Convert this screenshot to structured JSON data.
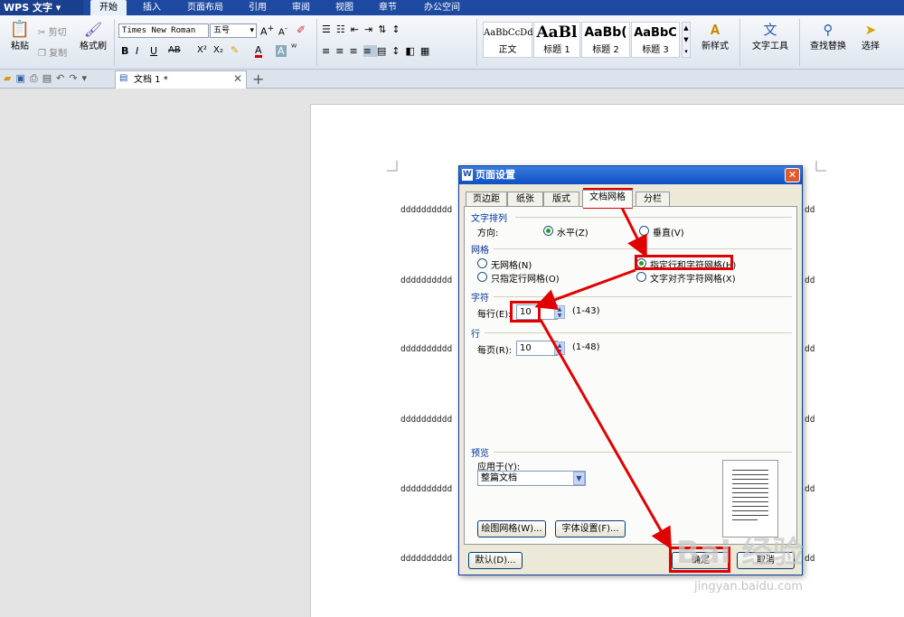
{
  "titlebar": {
    "app_name": "WPS 文字",
    "menu": [
      "开始",
      "插入",
      "页面布局",
      "引用",
      "审阅",
      "视图",
      "章节",
      "办公空间"
    ]
  },
  "ribbon": {
    "paste": "粘贴",
    "cut": "剪切",
    "copy": "复制",
    "format_painter": "格式刷",
    "font_name": "Times New Roman",
    "font_size": "五号",
    "styles": [
      {
        "preview": "AaBbCcDd",
        "label": "正文"
      },
      {
        "preview": "AaBl",
        "label": "标题 1"
      },
      {
        "preview": "AaBb(",
        "label": "标题 2"
      },
      {
        "preview": "AaBbC",
        "label": "标题 3"
      }
    ],
    "new_style": "新样式",
    "text_tools": "文字工具",
    "find_replace": "查找替换",
    "select": "选择"
  },
  "doc_tab": {
    "name": "文档 1 *"
  },
  "document": {
    "lines": [
      "dddddddddd",
      "dddddddddd",
      "dddddddddd",
      "dddddddddd",
      "dddddddddd",
      "dddddddddd"
    ],
    "right_text": "dd"
  },
  "dialog": {
    "title": "页面设置",
    "tabs": [
      "页边距",
      "纸张",
      "版式",
      "文档网格",
      "分栏"
    ],
    "active_tab": "文档网格",
    "text_direction": {
      "group": "文字排列",
      "label": "方向:",
      "options": [
        "水平(Z)",
        "垂直(V)"
      ],
      "selected": "水平(Z)"
    },
    "grid": {
      "group": "网格",
      "options": [
        "无网格(N)",
        "只指定行网格(O)",
        "指定行和字符网格(H)",
        "文字对齐字符网格(X)"
      ],
      "selected": "指定行和字符网格(H)"
    },
    "chars": {
      "group": "字符",
      "label": "每行(E):",
      "value": "10",
      "range": "(1-43)"
    },
    "lines": {
      "group": "行",
      "label": "每页(R):",
      "value": "10",
      "range": "(1-48)"
    },
    "preview": {
      "group": "预览",
      "apply_label": "应用于(Y):",
      "apply_value": "整篇文档"
    },
    "buttons": {
      "draw_grid": "绘图网格(W)...",
      "font_settings": "字体设置(F)...",
      "default": "默认(D)...",
      "ok": "确定",
      "cancel": "取消"
    }
  },
  "watermark": {
    "text": "Bai 经验",
    "url": "jingyan.baidu.com"
  },
  "colors": {
    "titlebar": "#1d4aa0",
    "dialog_title": "#0e4fc4",
    "highlight": "#e00000"
  }
}
